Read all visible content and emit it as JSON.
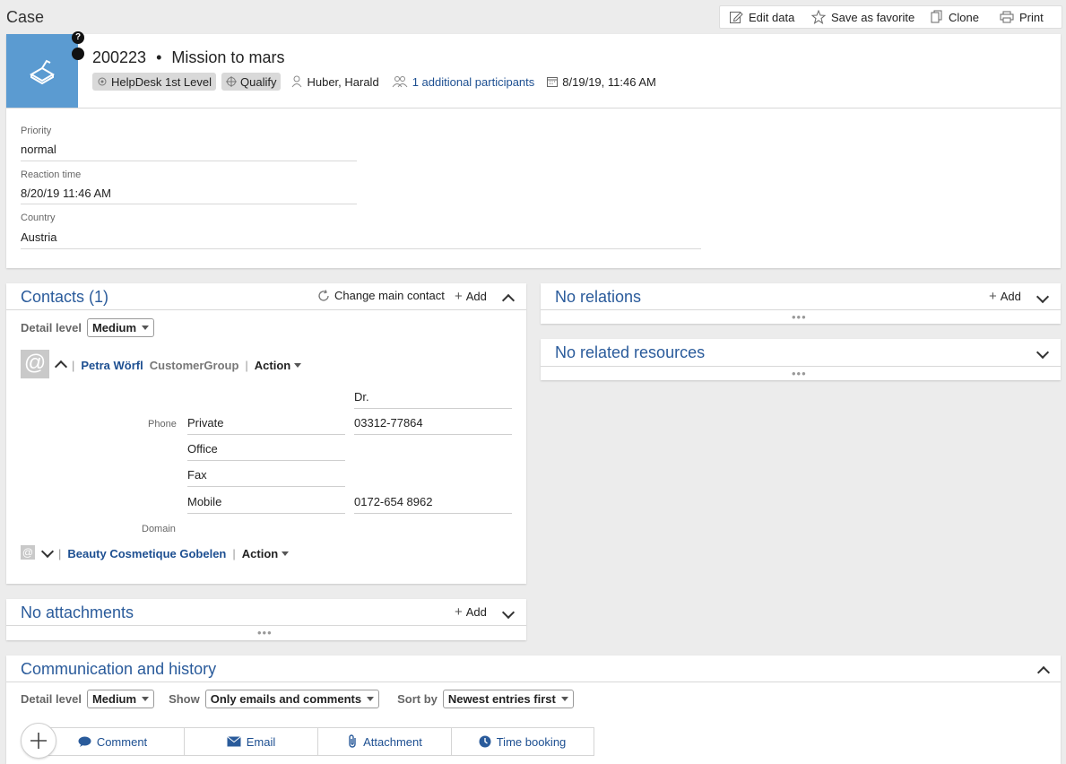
{
  "page": {
    "title": "Case"
  },
  "toolbar": {
    "edit": "Edit data",
    "favorite": "Save as favorite",
    "clone": "Clone",
    "print": "Print"
  },
  "header": {
    "help_glyph": "?",
    "case_id": "200223",
    "separator": "•",
    "case_title": "Mission to mars",
    "chips": [
      "HelpDesk 1st Level",
      "Qualify"
    ],
    "owner": "Huber, Harald",
    "participants": "1 additional participants",
    "created": "8/19/19, 11:46 AM"
  },
  "fields": [
    {
      "label": "Priority",
      "value": "normal"
    },
    {
      "label": "Reaction time",
      "value": "8/20/19 11:46 AM"
    },
    {
      "label": "Country",
      "value": "Austria"
    }
  ],
  "contacts": {
    "title": "Contacts (1)",
    "change_main": "Change main contact",
    "add": "Add",
    "detail_level_label": "Detail level",
    "detail_level_value": "Medium",
    "person": {
      "name": "Petra Wörfl",
      "group": "CustomerGroup",
      "action": "Action",
      "separator": "|"
    },
    "salutation": "Dr.",
    "phone_label": "Phone",
    "phones": [
      {
        "type": "Private",
        "number": "03312-77864"
      },
      {
        "type": "Office",
        "number": ""
      },
      {
        "type": "Fax",
        "number": ""
      },
      {
        "type": "Mobile",
        "number": "0172-654 8962"
      }
    ],
    "domain_label": "Domain",
    "company": {
      "name": "Beauty Cosmetique Gobelen",
      "action": "Action",
      "separator": "|"
    }
  },
  "relations": {
    "title": "No relations",
    "add": "Add",
    "dots": "•••"
  },
  "resources": {
    "title": "No related resources",
    "dots": "•••"
  },
  "attachments": {
    "title": "No attachments",
    "add": "Add",
    "dots": "•••"
  },
  "history": {
    "title": "Communication and history",
    "detail_level_label": "Detail level",
    "detail_level_value": "Medium",
    "show_label": "Show",
    "show_value": "Only emails and comments",
    "sort_label": "Sort by",
    "sort_value": "Newest entries first",
    "actions": [
      "Comment",
      "Email",
      "Attachment",
      "Time booking"
    ]
  },
  "colors": {
    "accent": "#2a5b9b",
    "case_icon_bg": "#5b9bd1"
  }
}
